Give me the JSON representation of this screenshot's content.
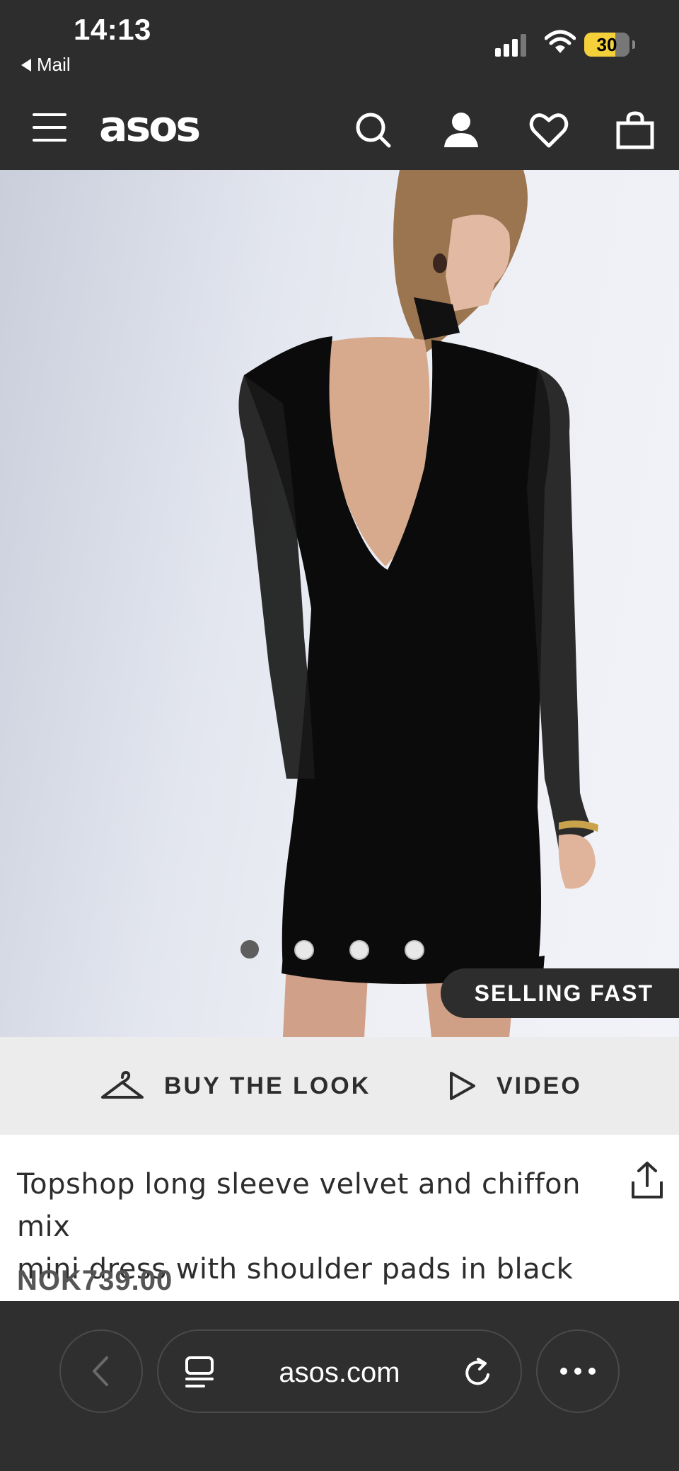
{
  "status_bar": {
    "time": "14:13",
    "back_app": "Mail",
    "battery": "30"
  },
  "header": {
    "logo": "asos",
    "icons": [
      "menu-icon",
      "search-icon",
      "account-icon",
      "heart-icon",
      "bag-icon"
    ]
  },
  "product_image": {
    "image_count": 4,
    "active_index": 0,
    "badge": "SELLING FAST"
  },
  "actions": {
    "buy_the_look": "BUY THE LOOK",
    "video": "VIDEO"
  },
  "product": {
    "title_line1": "Topshop long sleeve velvet and chiffon mix",
    "title_line2": "mini dress with shoulder pads in black",
    "price": "NOK739.00"
  },
  "browser": {
    "url": "asos.com"
  },
  "colors": {
    "header_bg": "#2d2d2d",
    "battery": "#f4d13b",
    "actions_bg": "#ececec"
  }
}
